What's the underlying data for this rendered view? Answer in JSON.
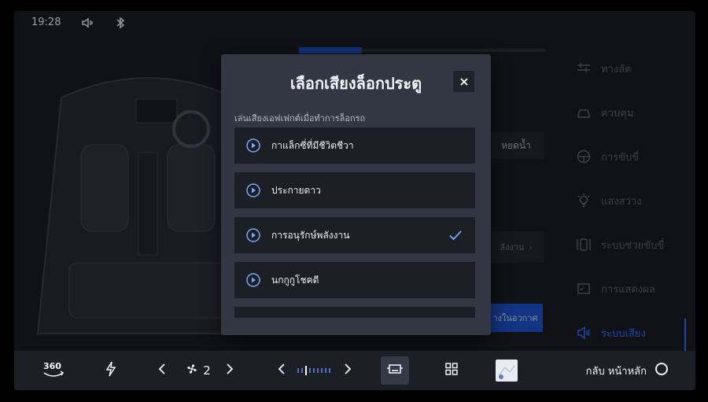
{
  "status": {
    "time": "19:28",
    "icons": [
      "speaker-mute-icon",
      "bluetooth-icon"
    ]
  },
  "background": {
    "button_right": "หยดน้ำ",
    "energy_fragment": "ลังงาน",
    "blue_fragment": "างในอวกาศ"
  },
  "sidebar": {
    "items": [
      {
        "label": "ทางลัด",
        "icon": "shortcut-icon",
        "active": false
      },
      {
        "label": "ควบคุม",
        "icon": "car-control-icon",
        "active": false
      },
      {
        "label": "การขับขี่",
        "icon": "steering-icon",
        "active": false
      },
      {
        "label": "แสงสว่าง",
        "icon": "light-icon",
        "active": false
      },
      {
        "label": "ระบบช่วยขับขี่",
        "icon": "driver-assist-icon",
        "active": false
      },
      {
        "label": "การแสดงผล",
        "icon": "display-icon",
        "active": false
      },
      {
        "label": "ระบบเสียง",
        "icon": "sound-icon",
        "active": true
      }
    ]
  },
  "modal": {
    "title": "เลือกเสียงล็อกประตู",
    "subtitle": "เล่นเสียงเอฟเฟกต์เมื่อทำการล็อกรถ",
    "close_icon": "close-icon",
    "options": [
      {
        "label": "กาแล็กซี่ที่มีชีวิตชีวา",
        "selected": false
      },
      {
        "label": "ประกายดาว",
        "selected": false
      },
      {
        "label": "การอนุรักษ์พลังงาน",
        "selected": true
      },
      {
        "label": "นกกูกูโชคดี",
        "selected": false
      }
    ]
  },
  "bottombar": {
    "view_360": "360",
    "fan_speed": "2",
    "home_label": "กลับ หน้าหลัก",
    "icons": [
      "360-view-icon",
      "defrost-icon",
      "fan-icon",
      "temperature-slider",
      "car-settings-icon",
      "apps-grid-icon",
      "map-thumbnail",
      "home-circle-icon"
    ]
  },
  "colors": {
    "accent": "#2f6df0",
    "modal_bg": "#323743",
    "option_bg": "#1c1f26"
  }
}
